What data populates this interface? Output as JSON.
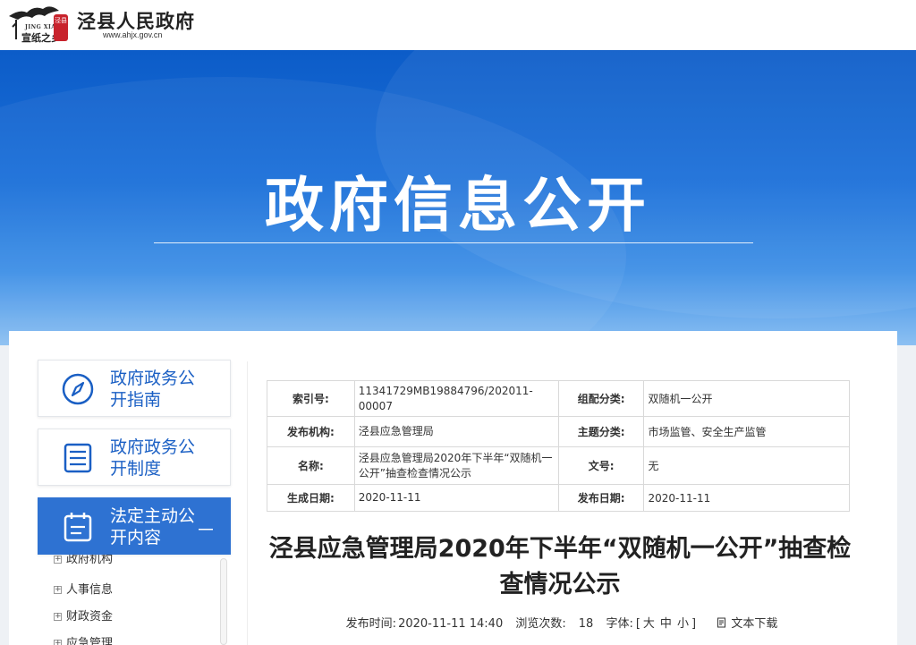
{
  "header": {
    "logo_en": "JING XIAN",
    "logo_cn": "宣纸之乡",
    "seal_text": "泾县",
    "site_name": "泾县人民政府",
    "site_url": "www.ahjx.gov.cn"
  },
  "banner": {
    "title": "政府信息公开"
  },
  "sidebar": {
    "items": [
      {
        "label": "政府政务公开指南",
        "icon": "compass-icon"
      },
      {
        "label": "政府政务公开制度",
        "icon": "list-icon"
      },
      {
        "label": "法定主动公开内容",
        "icon": "calendar-icon",
        "toggle": "－"
      }
    ],
    "tree": [
      {
        "label": "政府机构"
      },
      {
        "label": "人事信息"
      },
      {
        "label": "财政资金"
      },
      {
        "label": "应急管理"
      }
    ]
  },
  "meta": {
    "index_label": "索引号:",
    "index_value": "11341729MB19884796/202011-00007",
    "category_label": "组配分类:",
    "category_value": "双随机一公开",
    "publisher_label": "发布机构:",
    "publisher_value": "泾县应急管理局",
    "topic_label": "主题分类:",
    "topic_value": "市场监管、安全生产监管",
    "name_label": "名称:",
    "name_value": "泾县应急管理局2020年下半年“双随机一公开”抽查检查情况公示",
    "docno_label": "文号:",
    "docno_value": "无",
    "created_label": "生成日期:",
    "created_value": "2020-11-11",
    "published_label": "发布日期:",
    "published_value": "2020-11-11"
  },
  "article": {
    "title": "泾县应急管理局2020年下半年“双随机一公开”抽查检查情况公示",
    "publish_time_label": "发布时间:",
    "publish_time": "2020-11-11 14:40",
    "views_label": "浏览次数:",
    "views": "18",
    "font_label": "字体:",
    "font_open": "[",
    "font_large": "大",
    "font_medium": "中",
    "font_small": "小",
    "font_close": "]",
    "download_label": "文本下载"
  }
}
